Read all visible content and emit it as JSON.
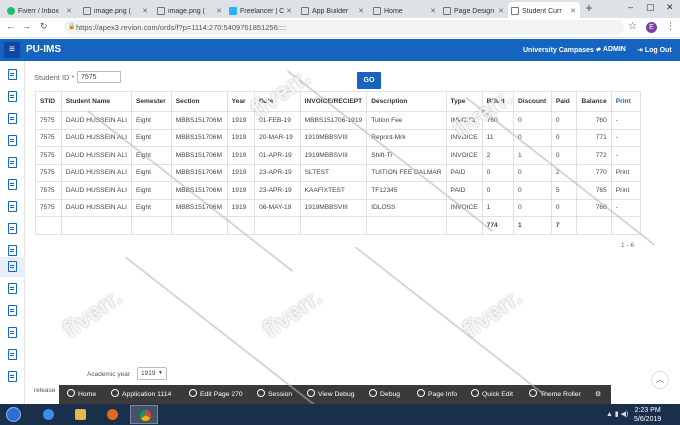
{
  "browser": {
    "tabs": [
      {
        "title": "Fiverr / Inbox",
        "icon": "fiverr-icon",
        "color": "#1dbf73"
      },
      {
        "title": "image.png (",
        "icon": "file-icon",
        "color": "#777777"
      },
      {
        "title": "image.png (",
        "icon": "file-icon",
        "color": "#777777"
      },
      {
        "title": "Freelancer | C",
        "icon": "freelancer-icon",
        "color": "#29b2fe"
      },
      {
        "title": "App Builder",
        "icon": "file-icon",
        "color": "#777777"
      },
      {
        "title": "Home",
        "icon": "file-icon",
        "color": "#777777"
      },
      {
        "title": "Page Design",
        "icon": "file-icon",
        "color": "#777777"
      },
      {
        "title": "Student Curr",
        "icon": "file-icon",
        "color": "#777777"
      }
    ],
    "url": "https://apex3.revion.com/ords/f?p=1114:270:5409761851256::::",
    "profile_initial": "E"
  },
  "app": {
    "name": "PU-IMS",
    "header": {
      "campuses": "University Campases",
      "user": "ADMIN",
      "logout": "Log Out"
    },
    "accent": "#1565c0"
  },
  "search": {
    "label": "Student ID *",
    "value": "7575",
    "go_label": "GO"
  },
  "table": {
    "columns": [
      "STID",
      "Student Name",
      "Semester",
      "Section",
      "Year",
      "Date",
      "INVOICE/RECIEPT",
      "Description",
      "Type",
      "Billed",
      "Discount",
      "Paid",
      "Balance",
      "Print"
    ],
    "rows": [
      [
        "7575",
        "DAUD HUSSEIN ALI",
        "Eight",
        "MBBS151706M",
        "1919",
        "01-FEB-19",
        "MBBS151706-1919",
        "Tution Fee",
        "INVOICE",
        "760",
        "0",
        "0",
        "760",
        "-"
      ],
      [
        "7575",
        "DAUD HUSSEIN ALI",
        "Eight",
        "MBBS151706M",
        "1919",
        "20-MAR-19",
        "1919MBBSVIII",
        "Reprint-Mrk",
        "INVOICE",
        "11",
        "0",
        "0",
        "771",
        "-"
      ],
      [
        "7575",
        "DAUD HUSSEIN ALI",
        "Eight",
        "MBBS151706M",
        "1919",
        "01-APR-19",
        "1919MBBSVIII",
        "Shift-Tr",
        "INVOICE",
        "2",
        "1",
        "0",
        "772",
        "-"
      ],
      [
        "7575",
        "DAUD HUSSEIN ALI",
        "Eight",
        "MBBS151706M",
        "1919",
        "23-APR-19",
        "SLTEST",
        "TUITION FEE DALMAR",
        "PAID",
        "0",
        "0",
        "2",
        "770",
        "Print"
      ],
      [
        "7575",
        "DAUD HUSSEIN ALI",
        "Eight",
        "MBBS151706M",
        "1919",
        "23-APR-19",
        "KAAFIXTEST",
        "TF12345",
        "PAID",
        "0",
        "0",
        "5",
        "765",
        "Print"
      ],
      [
        "7575",
        "DAUD HUSSEIN ALI",
        "Eight",
        "MBBS151706M",
        "1919",
        "06-MAY-19",
        "1919MBBSVIII",
        "IDLOSS",
        "INVOICE",
        "1",
        "0",
        "0",
        "766",
        "-"
      ]
    ],
    "totals": {
      "billed": "774",
      "discount": "1",
      "paid": "7"
    },
    "pagination": "1 - 6"
  },
  "filters": {
    "academic_year_label": "Academic year",
    "academic_year_value": "1919",
    "release_label": "release"
  },
  "debug_toolbar": [
    "Home",
    "Application 1114",
    "Edit Page 270",
    "Session",
    "View Debug",
    "Debug",
    "Page Info",
    "Quick Edit",
    "Theme Roller"
  ],
  "taskbar": {
    "time": "2:23 PM",
    "date": "5/6/2019"
  },
  "watermark": "fiverr."
}
